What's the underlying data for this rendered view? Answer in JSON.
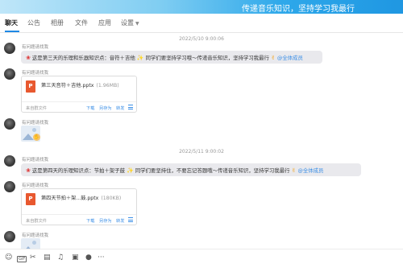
{
  "header": {
    "title": "传递音乐知识，坚持学习我最行"
  },
  "tabs": [
    {
      "label": "聊天"
    },
    {
      "label": "公告"
    },
    {
      "label": "相册"
    },
    {
      "label": "文件"
    },
    {
      "label": "应用"
    },
    {
      "label": "设置"
    }
  ],
  "messages": {
    "ts1": "2022/5/10 9:00:06",
    "ts2": "2022/5/11 9:00:02",
    "sender": "有问题请找我",
    "msg1": {
      "text": "这是第三天的乐理和乐器知识点：音符＋吉他",
      "text2": "同学们要坚持学习哦～传递音乐知识，坚持学习我最行",
      "mention": "@全体成员"
    },
    "file1": {
      "name": "第三天音符＋吉他.pptx",
      "size": "(1.96MB)"
    },
    "msg2": {
      "text": "这是第四天的乐理知识点：节拍＋架子鼓",
      "text2": "同学们要坚持住，不要忘记答题哦～传递音乐知识，坚持学习我最行",
      "mention": "@全体成员"
    },
    "file2": {
      "name": "第四天节拍＋架...鼓.pptx",
      "size": "(180KB)"
    },
    "file_source": "来自群文件",
    "download": "下载",
    "save_as": "另存为",
    "forward": "转发"
  },
  "toolbar": {
    "gif_label": "GIF",
    "more_label": "···"
  },
  "colors": {
    "accent": "#3a8ee6",
    "header_gradient_end": "#1f97e2",
    "ppt": "#e8582f"
  }
}
